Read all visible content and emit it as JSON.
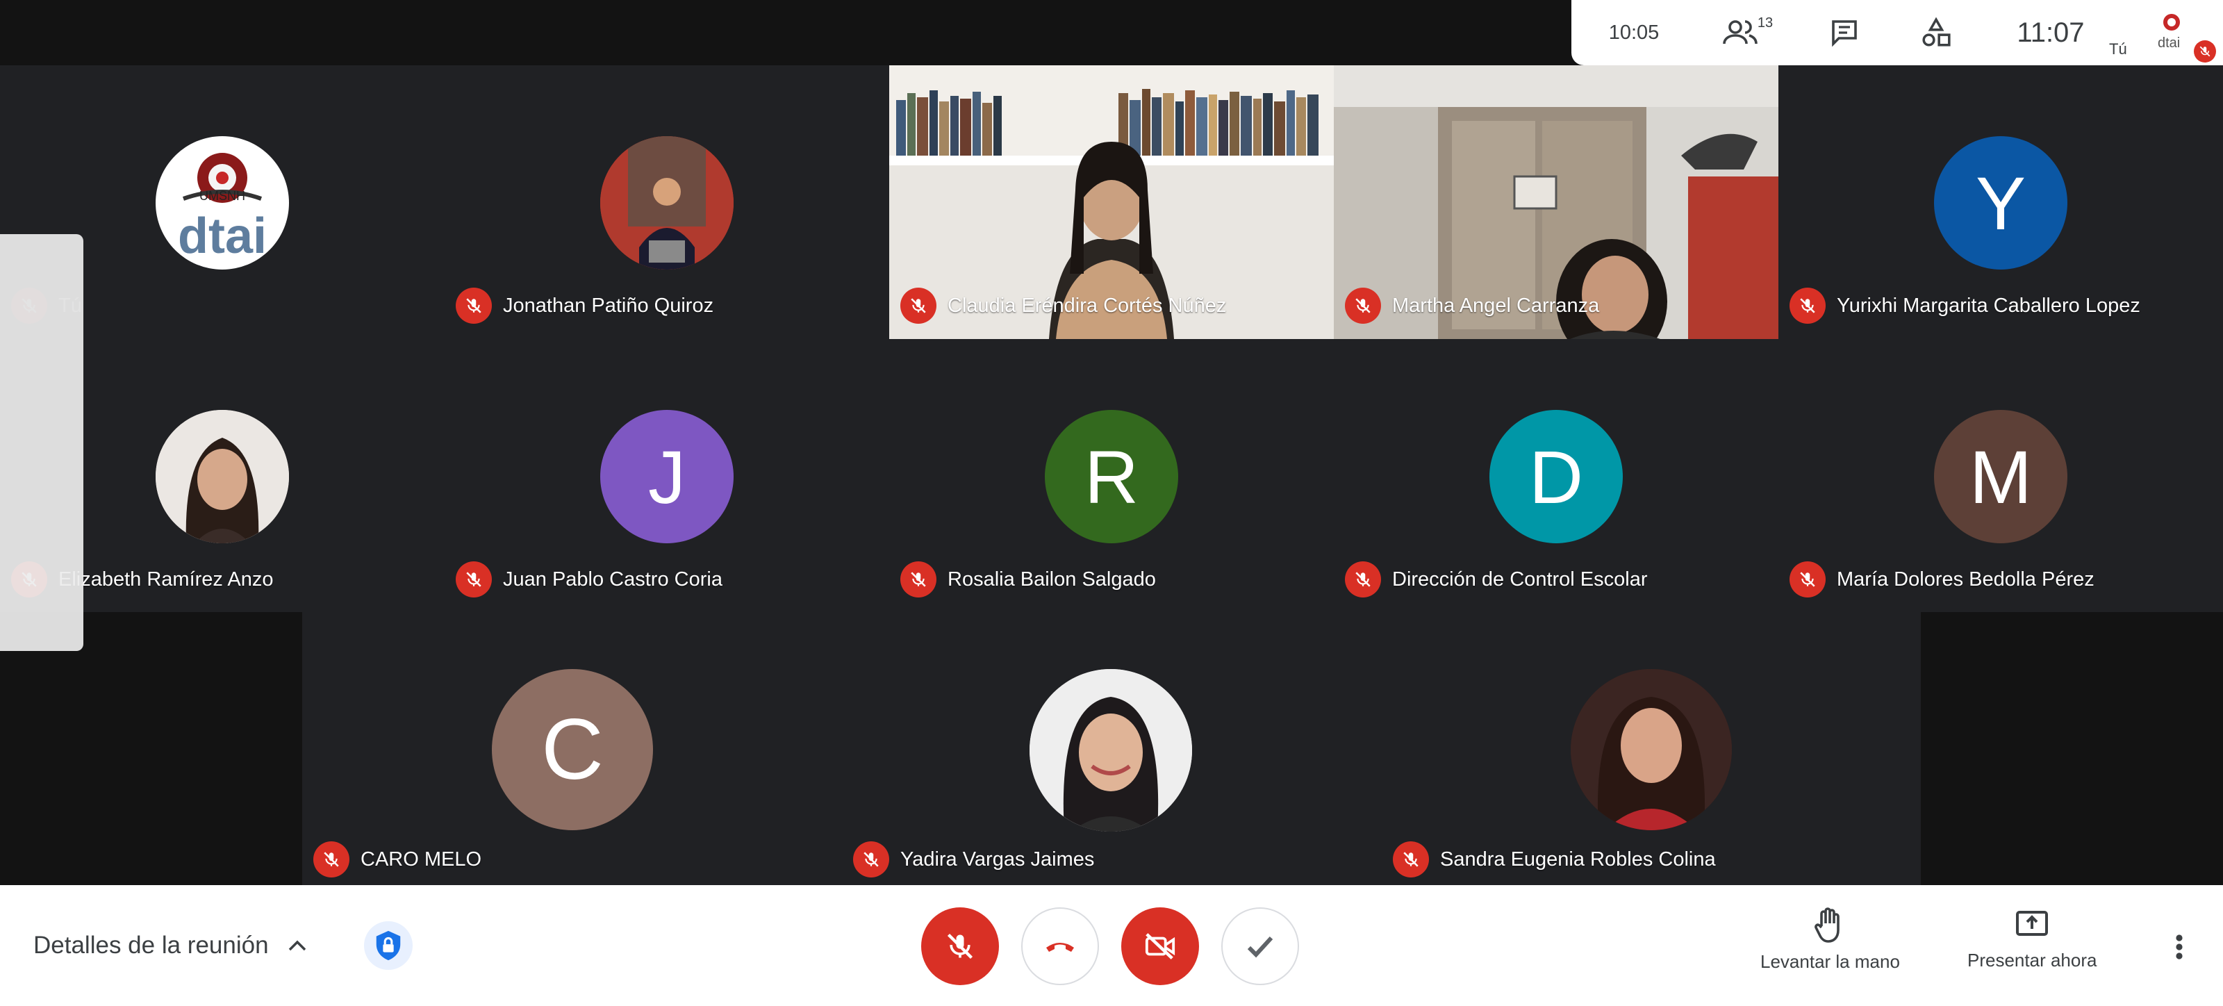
{
  "top_bar": {
    "meeting_timer": "10:05",
    "participant_count": "13",
    "clock": "11:07",
    "self_label": "Tú"
  },
  "participants_row1": [
    {
      "name": "Tú",
      "type": "logo"
    },
    {
      "name": "Jonathan Patiño Quiroz",
      "type": "photo"
    },
    {
      "name": "Claudia Eréndira Cortés Núñez",
      "type": "video"
    },
    {
      "name": "Martha Angel Carranza",
      "type": "video"
    },
    {
      "name": "Yurixhi Margarita Caballero Lopez",
      "type": "letter",
      "letter": "Y",
      "color": "#0b57a4"
    }
  ],
  "participants_row2": [
    {
      "name": "Elizabeth Ramírez Anzo",
      "type": "photo"
    },
    {
      "name": "Juan Pablo Castro Coria",
      "type": "letter",
      "letter": "J",
      "color": "#7e57c2"
    },
    {
      "name": "Rosalia Bailon Salgado",
      "type": "letter",
      "letter": "R",
      "color": "#33691e"
    },
    {
      "name": "Dirección de Control Escolar",
      "type": "letter",
      "letter": "D",
      "color": "#0097a7"
    },
    {
      "name": "María Dolores Bedolla Pérez",
      "type": "letter",
      "letter": "M",
      "color": "#5d4037"
    }
  ],
  "participants_row3": [
    {
      "name": "CARO MELO",
      "type": "letter",
      "letter": "C",
      "color": "#8d6e63"
    },
    {
      "name": "Yadira Vargas Jaimes",
      "type": "photo"
    },
    {
      "name": "Sandra Eugenia Robles Colina",
      "type": "photo"
    }
  ],
  "self_tile_logo_text": "dtai",
  "bottom_bar": {
    "details_label": "Detalles de la reunión",
    "raise_hand_label": "Levantar la mano",
    "present_label": "Presentar ahora"
  },
  "colors": {
    "mute_red": "#d93025",
    "grid_bg": "#202124",
    "bar_bg": "#ffffff"
  }
}
